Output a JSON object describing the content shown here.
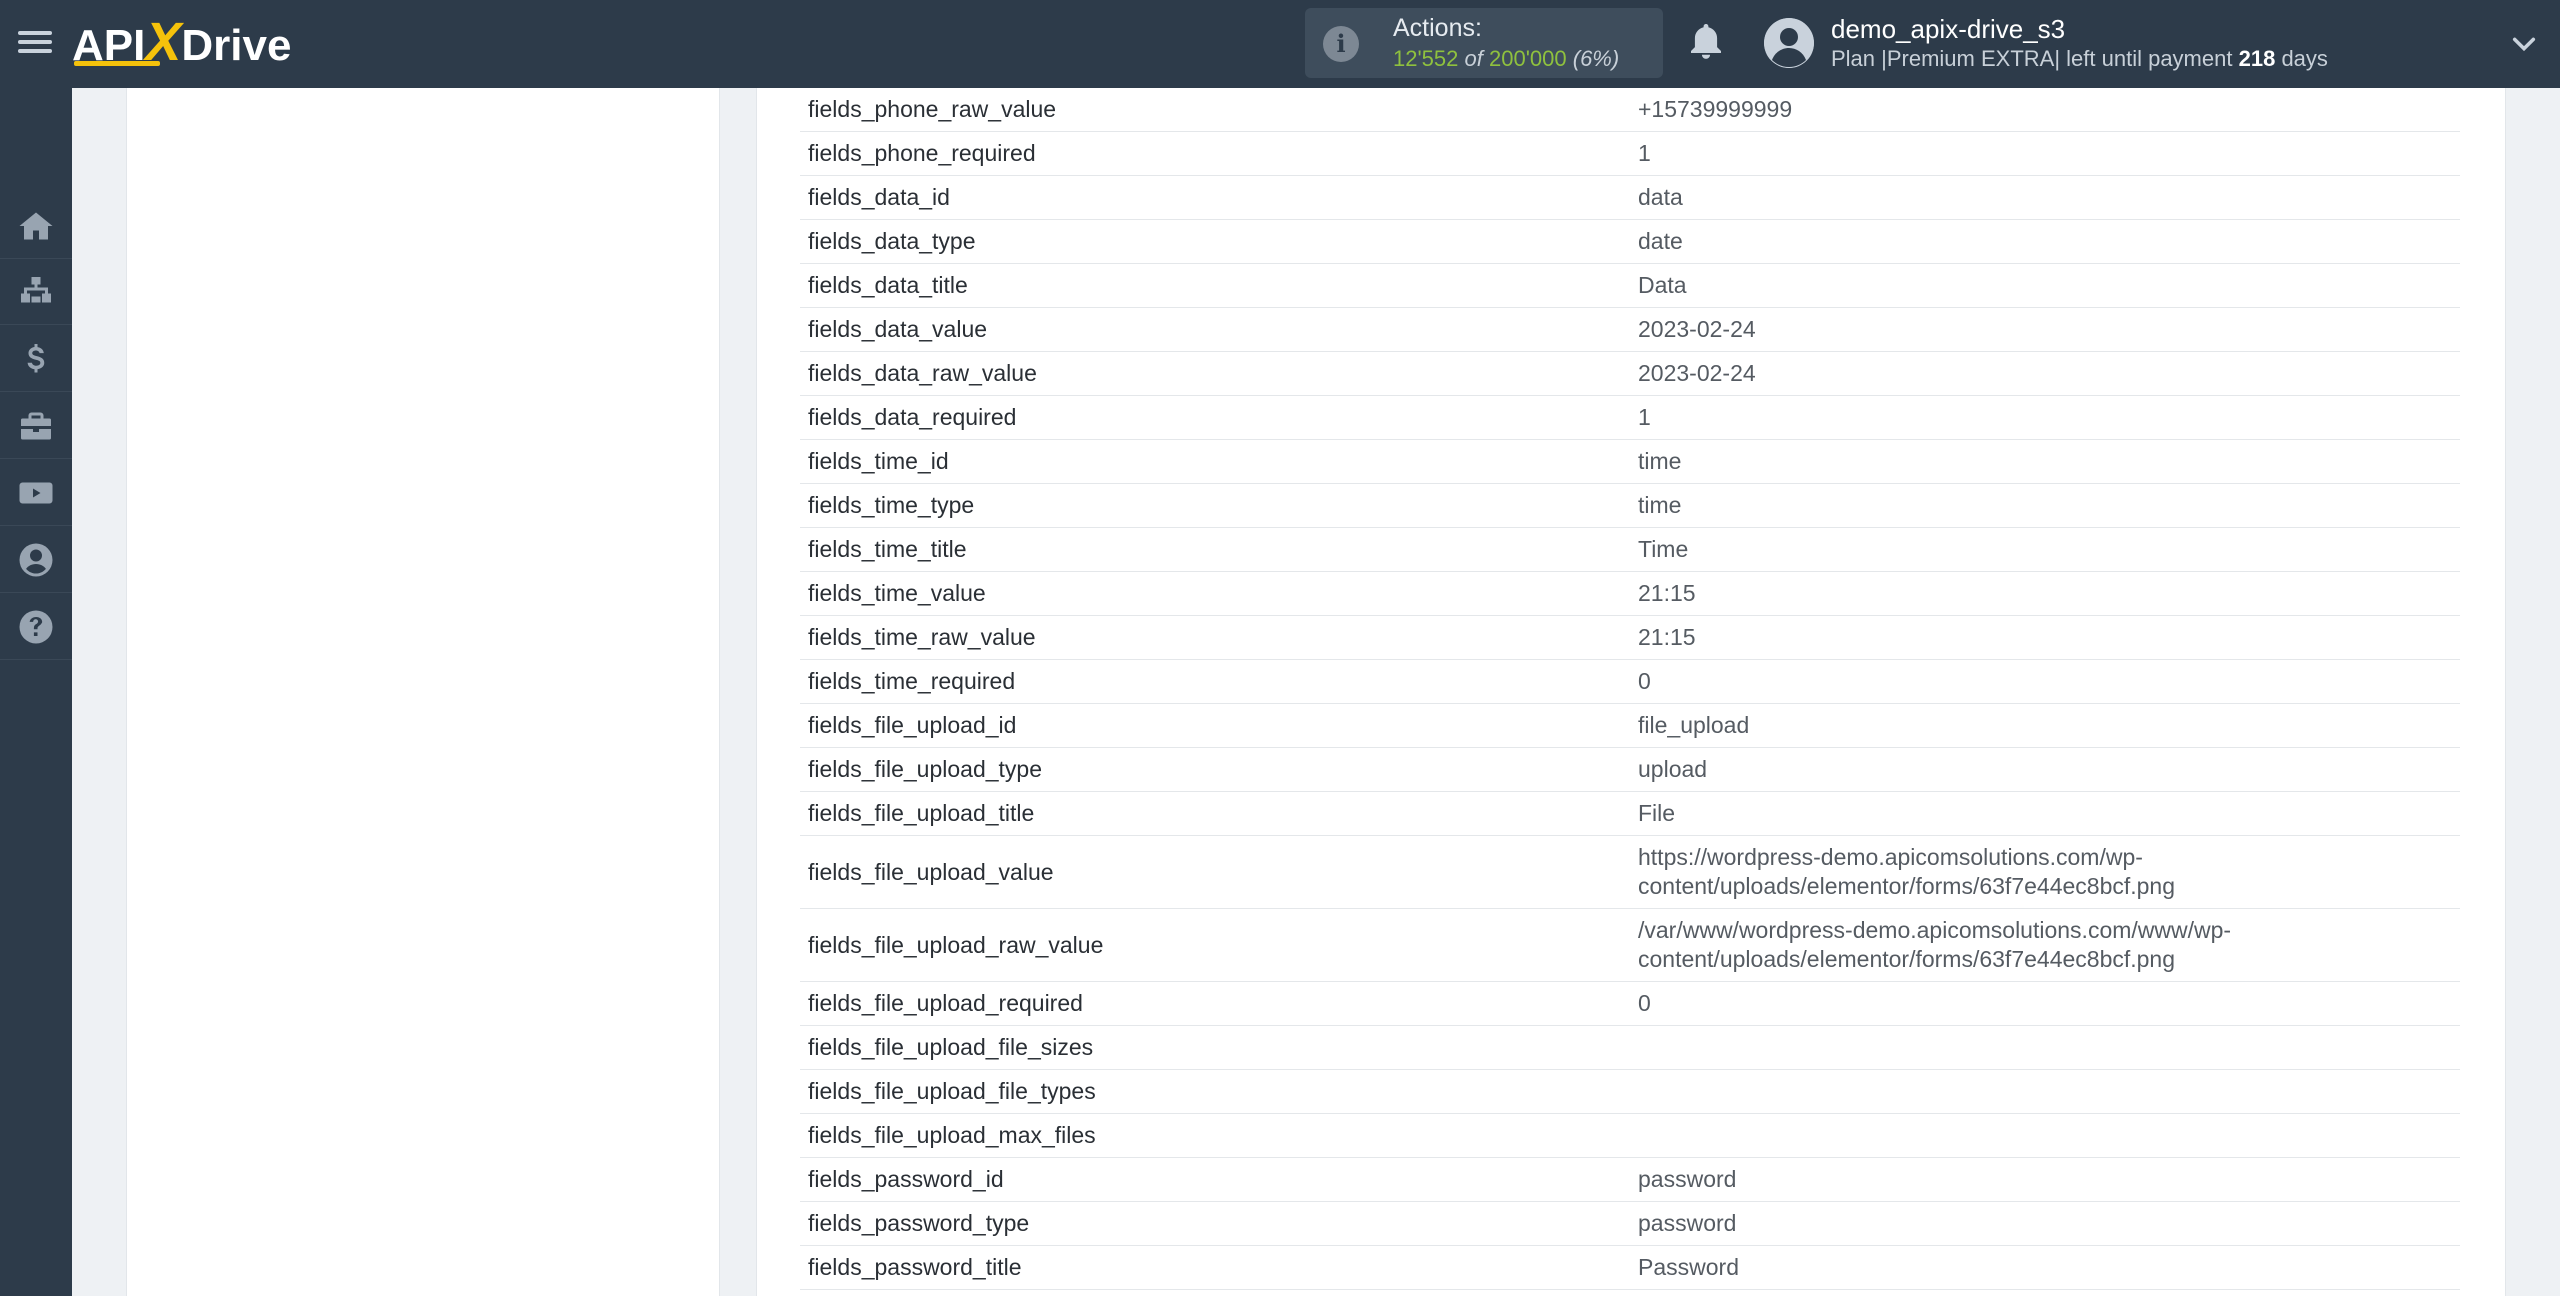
{
  "header": {
    "logo_text_api": "API",
    "logo_text_x": "X",
    "logo_text_drive": "Drive",
    "actions_label": "Actions:",
    "actions_used": "12'552",
    "actions_of": "of",
    "actions_total": "200'000",
    "actions_percent": "(6%)",
    "user_name": "demo_apix-drive_s3",
    "plan_prefix": "Plan |Premium EXTRA| left until payment",
    "plan_days": "218",
    "plan_suffix": "days"
  },
  "sidebar": {
    "items": [
      {
        "icon": "home-icon"
      },
      {
        "icon": "sitemap-icon"
      },
      {
        "icon": "dollar-icon"
      },
      {
        "icon": "briefcase-icon"
      },
      {
        "icon": "youtube-icon"
      },
      {
        "icon": "user-circle-icon"
      },
      {
        "icon": "help-icon"
      }
    ]
  },
  "rows": [
    {
      "key": "fields_phone_raw_value",
      "value": "+15739999999"
    },
    {
      "key": "fields_phone_required",
      "value": "1"
    },
    {
      "key": "fields_data_id",
      "value": "data"
    },
    {
      "key": "fields_data_type",
      "value": "date"
    },
    {
      "key": "fields_data_title",
      "value": "Data"
    },
    {
      "key": "fields_data_value",
      "value": "2023-02-24"
    },
    {
      "key": "fields_data_raw_value",
      "value": "2023-02-24"
    },
    {
      "key": "fields_data_required",
      "value": "1"
    },
    {
      "key": "fields_time_id",
      "value": "time"
    },
    {
      "key": "fields_time_type",
      "value": "time"
    },
    {
      "key": "fields_time_title",
      "value": "Time"
    },
    {
      "key": "fields_time_value",
      "value": "21:15"
    },
    {
      "key": "fields_time_raw_value",
      "value": "21:15"
    },
    {
      "key": "fields_time_required",
      "value": "0"
    },
    {
      "key": "fields_file_upload_id",
      "value": "file_upload"
    },
    {
      "key": "fields_file_upload_type",
      "value": "upload"
    },
    {
      "key": "fields_file_upload_title",
      "value": "File"
    },
    {
      "key": "fields_file_upload_value",
      "value": "https://wordpress-demo.apicomsolutions.com/wp-content/uploads/elementor/forms/63f7e44ec8bcf.png"
    },
    {
      "key": "fields_file_upload_raw_value",
      "value": "/var/www/wordpress-demo.apicomsolutions.com/www/wp-content/uploads/elementor/forms/63f7e44ec8bcf.png"
    },
    {
      "key": "fields_file_upload_required",
      "value": "0"
    },
    {
      "key": "fields_file_upload_file_sizes",
      "value": ""
    },
    {
      "key": "fields_file_upload_file_types",
      "value": ""
    },
    {
      "key": "fields_file_upload_max_files",
      "value": ""
    },
    {
      "key": "fields_password_id",
      "value": "password"
    },
    {
      "key": "fields_password_type",
      "value": "password"
    },
    {
      "key": "fields_password_title",
      "value": "Password"
    }
  ],
  "colors": {
    "header_bg": "#2d3b4a",
    "accent_yellow": "#f5c20b",
    "actions_green": "#8fc13e"
  }
}
